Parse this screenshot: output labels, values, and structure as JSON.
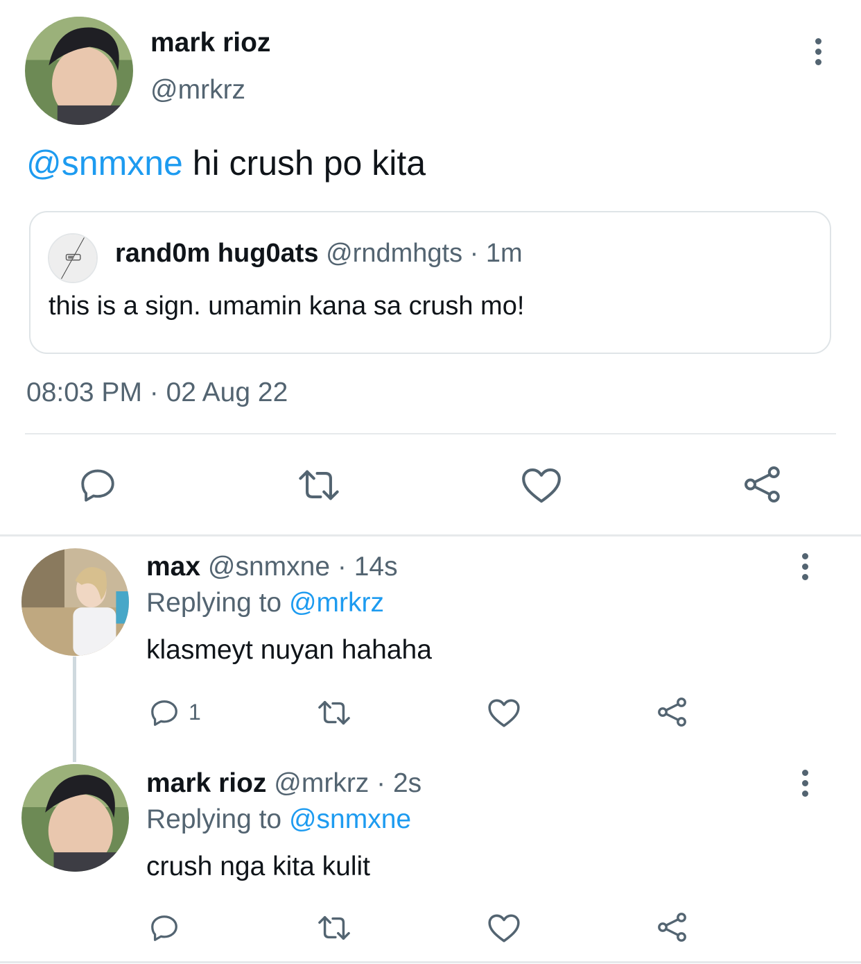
{
  "main_tweet": {
    "author_name": "mark rioz",
    "author_handle": "@mrkrz",
    "mention": "@snmxne",
    "text": " hi crush po kita",
    "timestamp": "08:03 PM · 02 Aug 22",
    "quoted": {
      "author_name": "rand0m hug0ats",
      "meta": "@rndmhgts · 1m",
      "text": "this is a sign. umamin kana sa crush mo!"
    }
  },
  "replies": [
    {
      "author_name": "max",
      "meta": "@snmxne · 14s",
      "replying_prefix": "Replying to ",
      "replying_to": "@mrkrz",
      "text": "klasmeyt nuyan hahaha",
      "reply_count": "1"
    },
    {
      "author_name": "mark rioz",
      "meta": "@mrkrz · 2s",
      "replying_prefix": "Replying to ",
      "replying_to": "@snmxne",
      "text": "crush nga kita kulit",
      "reply_count": ""
    }
  ],
  "icons": {
    "reply": "comment-bubble-icon",
    "retweet": "retweet-icon",
    "like": "heart-icon",
    "share": "share-icon",
    "more": "more-vertical-icon"
  },
  "colors": {
    "accent": "#1d9bf0",
    "secondary_text": "#536471",
    "border": "#cfd9de"
  }
}
